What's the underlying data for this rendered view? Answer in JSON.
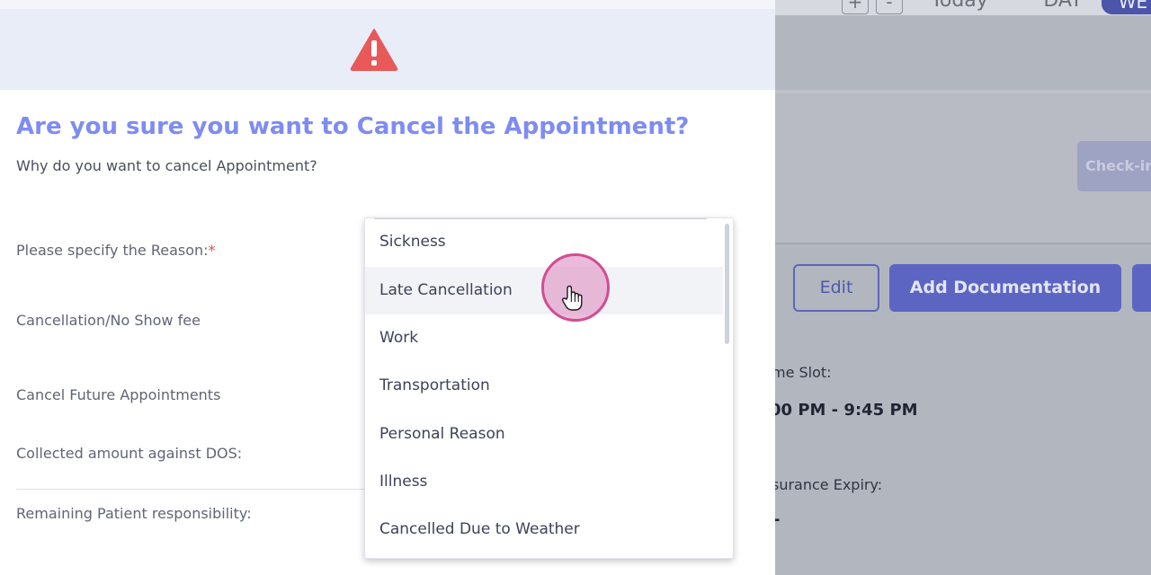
{
  "background": {
    "toolbar": {
      "plus": "+",
      "minus": "-",
      "today": "Today",
      "day": "DAY",
      "week": "WE"
    },
    "checkin_label": "Check-in",
    "edit_label": "Edit",
    "add_documentation_label": "Add Documentation",
    "time_slot_label": "me Slot:",
    "time_slot_value": "00 PM - 9:45 PM",
    "insurance_expiry_label": "surance Expiry:",
    "insurance_expiry_value": "-"
  },
  "modal": {
    "warning_icon": "warning-triangle-icon",
    "title": "Are you sure you want to Cancel the Appointment?",
    "subtitle": "Why do you want to cancel Appointment?",
    "fields": {
      "reason_label": "Please specify the Reason:",
      "reason_required_marker": "*",
      "fee_label": "Cancellation/No Show fee",
      "future_label": "Cancel Future Appointments",
      "collected_label": "Collected amount against DOS:",
      "remaining_label": "Remaining Patient responsibility:"
    },
    "reason_options": [
      "Sickness",
      "Late Cancellation",
      "Work",
      "Transportation",
      "Personal Reason",
      "Illness",
      "Cancelled Due to Weather"
    ],
    "hovered_option": "Late Cancellation"
  },
  "colors": {
    "title": "#7e8cf2",
    "warning": "#e85a5a",
    "required": "#e34b4b",
    "cursor_ring": "#d24d91",
    "primary_button": "#5c66c2"
  }
}
